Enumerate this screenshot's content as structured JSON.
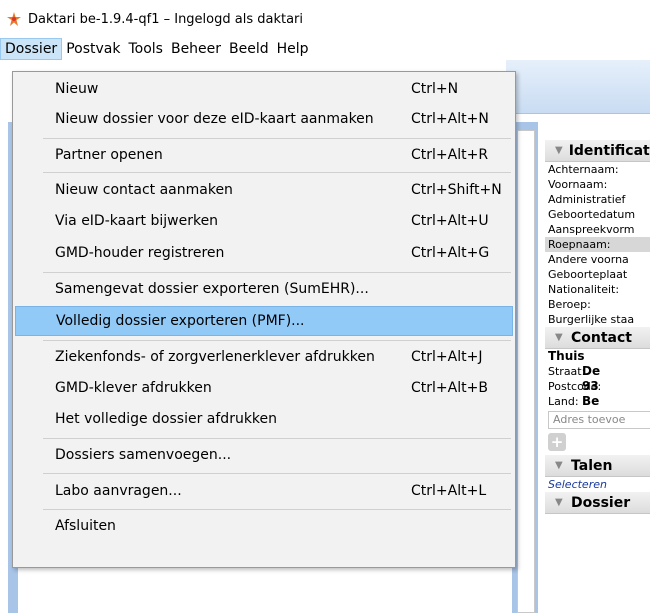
{
  "window": {
    "title": "Daktari be-1.9.4-qf1 – Ingelogd als daktari",
    "logo_icon": "daktari-logo-icon"
  },
  "menubar": [
    "Dossier",
    "Postvak",
    "Tools",
    "Beheer",
    "Beeld",
    "Help"
  ],
  "dossier_menu": {
    "items": [
      {
        "label": "Nieuw",
        "shortcut": "Ctrl+N"
      },
      {
        "label": "Nieuw dossier voor deze eID-kaart aanmaken",
        "shortcut": "Ctrl+Alt+N"
      },
      {
        "label": "Partner openen",
        "shortcut": "Ctrl+Alt+R"
      },
      {
        "label": "Nieuw contact aanmaken",
        "shortcut": "Ctrl+Shift+N"
      },
      {
        "label": "Via eID-kaart bijwerken",
        "shortcut": "Ctrl+Alt+U"
      },
      {
        "label": "GMD-houder registreren",
        "shortcut": "Ctrl+Alt+G"
      },
      {
        "label": "Samengevat dossier exporteren (SumEHR)...",
        "shortcut": ""
      },
      {
        "label": "Volledig dossier exporteren (PMF)...",
        "shortcut": ""
      },
      {
        "label": "Ziekenfonds- of zorgverlenerklever afdrukken",
        "shortcut": "Ctrl+Alt+J"
      },
      {
        "label": "GMD-klever afdrukken",
        "shortcut": "Ctrl+Alt+B"
      },
      {
        "label": "Het volledige dossier afdrukken",
        "shortcut": ""
      },
      {
        "label": "Dossiers samenvoegen...",
        "shortcut": ""
      },
      {
        "label": "Labo aanvragen...",
        "shortcut": "Ctrl+Alt+L"
      },
      {
        "label": "Afsluiten",
        "shortcut": ""
      }
    ],
    "highlighted_item": "Volledig dossier exporteren (PMF)..."
  },
  "side_panel": {
    "identificatie": {
      "header": "Identificatie",
      "fields": [
        "Achternaam:",
        "Voornaam:",
        "Administratief",
        "Geboortedatum",
        "Aanspreekvorm",
        "Roepnaam:",
        "Andere voorna",
        "Geboorteplaat",
        "Nationaliteit:",
        "Beroep:",
        "Burgerlijke staa"
      ]
    },
    "contact": {
      "header": "Contact",
      "group": "Thuis",
      "rows": [
        {
          "key": "Straat:",
          "value": "De"
        },
        {
          "key": "Postcode:",
          "value": "93"
        },
        {
          "key": "Land:",
          "value": "Be"
        }
      ],
      "address_placeholder": "Adres toevoe"
    },
    "talen": {
      "header": "Talen",
      "link": "Selecteren"
    },
    "dossier": {
      "header": "Dossier"
    }
  }
}
